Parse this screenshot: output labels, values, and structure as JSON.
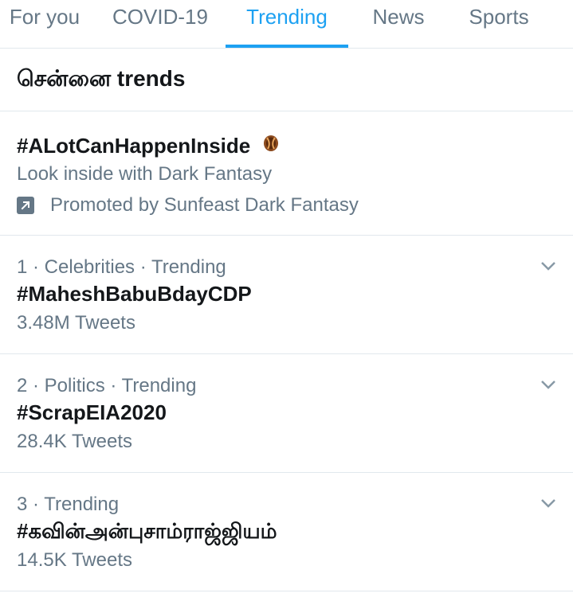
{
  "tabs": [
    {
      "label": "For you",
      "active": false
    },
    {
      "label": "COVID-19",
      "active": false
    },
    {
      "label": "Trending",
      "active": true
    },
    {
      "label": "News",
      "active": false
    },
    {
      "label": "Sports",
      "active": false
    }
  ],
  "location": {
    "title": "சென்னை trends"
  },
  "promoted": {
    "hashtag": "#ALotCanHappenInside",
    "emoji_icon": "cookie-emoji-icon",
    "description": "Look inside with Dark Fantasy",
    "promoted_by": "Promoted by Sunfeast Dark Fantasy",
    "icon": "promoted-arrow-icon"
  },
  "trends": [
    {
      "meta": "1 · Celebrities · Trending",
      "hashtag": "#MaheshBabuBdayCDP",
      "tweets": "3.48M Tweets"
    },
    {
      "meta": "2 · Politics · Trending",
      "hashtag": "#ScrapEIA2020",
      "tweets": "28.4K Tweets"
    },
    {
      "meta": "3 · Trending",
      "hashtag": "#கவின்அன்புசாம்ராஜ்ஜியம்",
      "tweets": "14.5K Tweets"
    }
  ],
  "colors": {
    "accent": "#1da1f2",
    "secondary_text": "#657786",
    "primary_text": "#14171a",
    "divider": "#e1e8ed"
  }
}
